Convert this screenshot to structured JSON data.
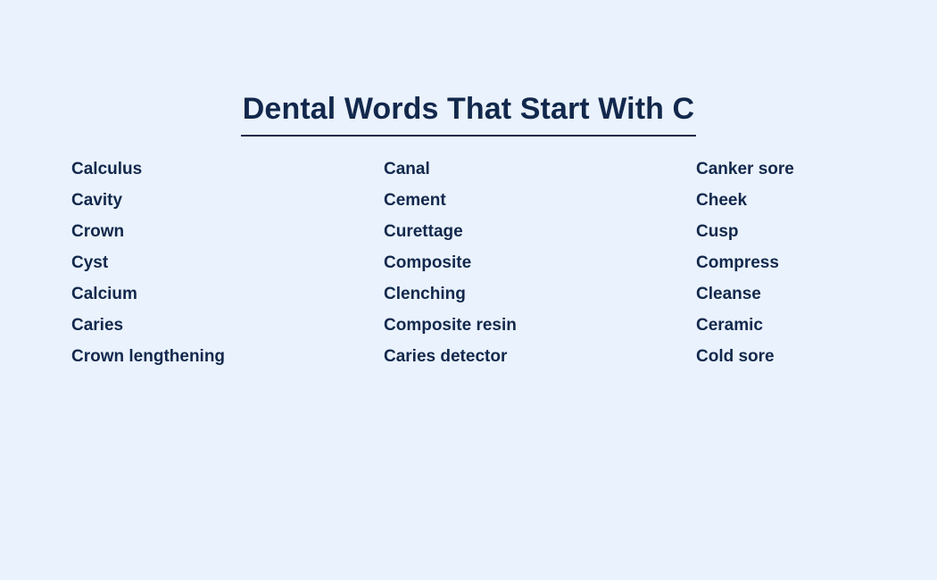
{
  "page": {
    "background_color": "#eaf2fd",
    "text_color": "#12284c"
  },
  "header": {
    "title": "Dental Words That Start With C"
  },
  "word_list": {
    "columns": [
      {
        "items": [
          "Calculus",
          "Cavity",
          "Crown",
          "Cyst",
          "Calcium",
          "Caries",
          "Crown lengthening"
        ]
      },
      {
        "items": [
          "Canal",
          "Cement",
          "Curettage",
          "Composite",
          "Clenching",
          "Composite resin",
          "Caries detector"
        ]
      },
      {
        "items": [
          "Canker sore",
          "Cheek",
          "Cusp",
          "Compress",
          "Cleanse",
          "Ceramic",
          "Cold sore"
        ]
      }
    ]
  }
}
